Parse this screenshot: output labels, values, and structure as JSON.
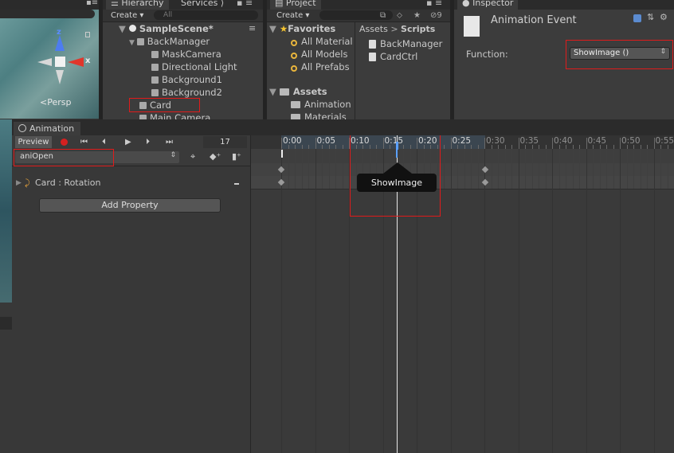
{
  "scene": {
    "persp_label": "<Persp",
    "axis_x": "x",
    "axis_z": "z"
  },
  "hierarchy": {
    "tabs": [
      "Hierarchy",
      "Services"
    ],
    "create": "Create ▾",
    "search_placeholder": "All",
    "scene_name": "SampleScene*",
    "items": [
      "BackManager",
      "MaskCamera",
      "Directional Light",
      "Background1",
      "Background2",
      "Card",
      "Main Camera"
    ]
  },
  "project": {
    "tab": "Project",
    "create": "Create ▾",
    "badge": "9",
    "favorites_label": "Favorites",
    "favorites": [
      "All Material",
      "All Models",
      "All Prefabs"
    ],
    "assets_label": "Assets",
    "asset_folders": [
      "Animation",
      "Materials"
    ],
    "breadcrumb_root": "Assets",
    "breadcrumb_sep": ">",
    "breadcrumb_current": "Scripts",
    "files": [
      "BackManager",
      "CardCtrl"
    ]
  },
  "inspector": {
    "tab": "Inspector",
    "title": "Animation Event",
    "function_label": "Function:",
    "function_value": "ShowImage ()"
  },
  "animation": {
    "tab": "Animation",
    "preview_label": "Preview",
    "frame": "17",
    "clip": "aniOpen",
    "property": "Card : Rotation",
    "add_property": "Add Property",
    "timeline_labels": [
      "0:00",
      "0:05",
      "0:10",
      "0:15",
      "0:20",
      "0:25",
      "0:30",
      "0:35",
      "0:40",
      "0:45",
      "0:50",
      "0:55"
    ],
    "tooltip": "ShowImage"
  },
  "colors": {
    "highlight": "#e01b1b",
    "record": "#d42020",
    "playhead": "#5aa0ff"
  }
}
